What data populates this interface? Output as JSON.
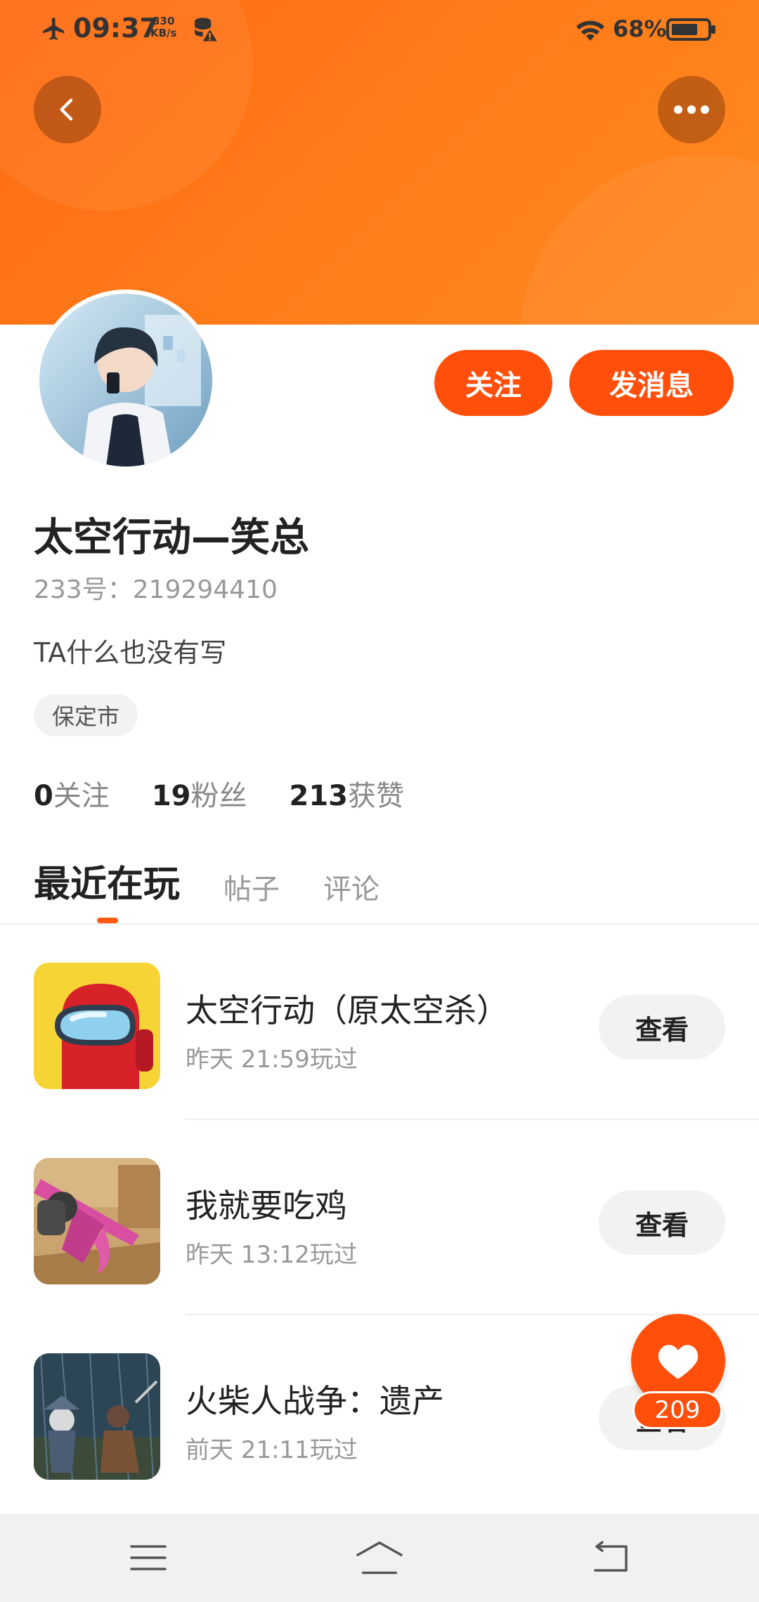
{
  "status_bar": {
    "time": "09:37",
    "speed_value": "330",
    "speed_unit": "KB/s",
    "battery_percent": "68%"
  },
  "header": {
    "back_icon": "chevron-left-icon",
    "more_icon": "more-dots-icon"
  },
  "profile": {
    "username": "太空行动—笑总",
    "uid_text": "233号：219294410",
    "bio": "TA什么也没有写",
    "location": "保定市",
    "follow_label": "关注",
    "message_label": "发消息"
  },
  "stats": [
    {
      "num": "0",
      "label": "关注"
    },
    {
      "num": "19",
      "label": "粉丝"
    },
    {
      "num": "213",
      "label": "获赞"
    }
  ],
  "tabs": [
    {
      "label": "最近在玩",
      "active": true
    },
    {
      "label": "帖子",
      "active": false
    },
    {
      "label": "评论",
      "active": false
    }
  ],
  "games": [
    {
      "title": "太空行动（原太空杀）",
      "time": "昨天 21:59玩过",
      "button": "查看"
    },
    {
      "title": "我就要吃鸡",
      "time": "昨天 13:12玩过",
      "button": "查看"
    },
    {
      "title": "火柴人战争：遗产",
      "time": "前天 21:11玩过",
      "button": "查看"
    }
  ],
  "like": {
    "count": "209"
  },
  "colors": {
    "accent": "#ff4f0b",
    "banner": "#ff7a18"
  }
}
